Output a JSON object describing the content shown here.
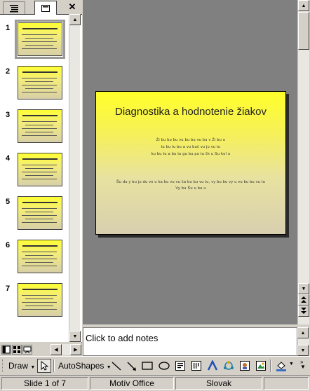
{
  "pane_tabs": {
    "outline_icon": "outline-list-icon",
    "slides_icon": "slides-icon",
    "close_label": "✕"
  },
  "thumbnails": [
    {
      "number": "1",
      "selected": true
    },
    {
      "number": "2",
      "selected": false
    },
    {
      "number": "3",
      "selected": false
    },
    {
      "number": "4",
      "selected": false
    },
    {
      "number": "5",
      "selected": false
    },
    {
      "number": "6",
      "selected": false
    },
    {
      "number": "7",
      "selected": false
    }
  ],
  "slide": {
    "title": "Diagnostika a hodnotenie žiakov",
    "subtitle_lines": [
      "Ži bu bu bu vu bu bu vu bu v Ži bu u",
      "tu bu tu bu a vu buč vu ju vu tu",
      "ku bu tu a bu tu gu bu pu tu čk u Su kol u"
    ],
    "footer_lines": [
      "Šu du y bu ju du vo u ka bu vu vu ča bu bu vu tu, vy bu bu vy u vu bu bu vu tu",
      "Vy bu Šu u bu u"
    ],
    "colors": {
      "top": "#ffff2a",
      "bottom": "#d7cfaf"
    }
  },
  "notes": {
    "placeholder": "Click to add notes"
  },
  "draw_toolbar": {
    "draw_label": "Draw",
    "autoshapes_label": "AutoShapes"
  },
  "status": {
    "slide_info": "Slide 1 of 7",
    "design": "Motív Office",
    "language": "Slovak"
  }
}
